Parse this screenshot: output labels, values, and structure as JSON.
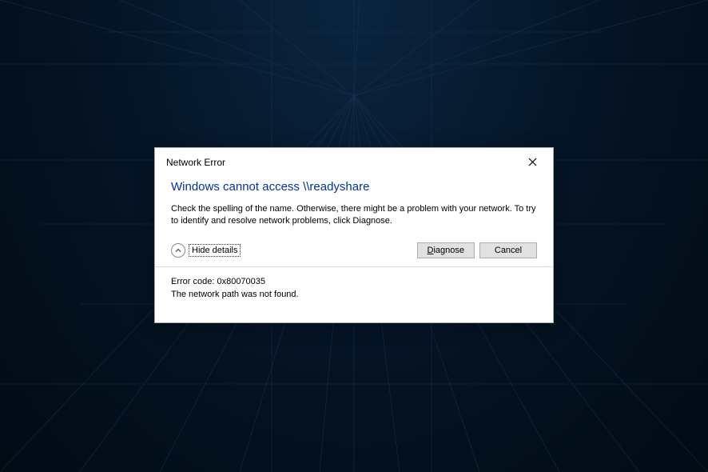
{
  "dialog": {
    "title": "Network Error",
    "heading": "Windows cannot access \\\\readyshare",
    "description": "Check the spelling of the name. Otherwise, there might be a problem with your network. To try to identify and resolve network problems, click Diagnose.",
    "details_toggle_label": "Hide details",
    "diagnose_label": "Diagnose",
    "cancel_label": "Cancel",
    "error_code_line": "Error code: 0x80070035",
    "error_message_line": "The network path was not found."
  }
}
